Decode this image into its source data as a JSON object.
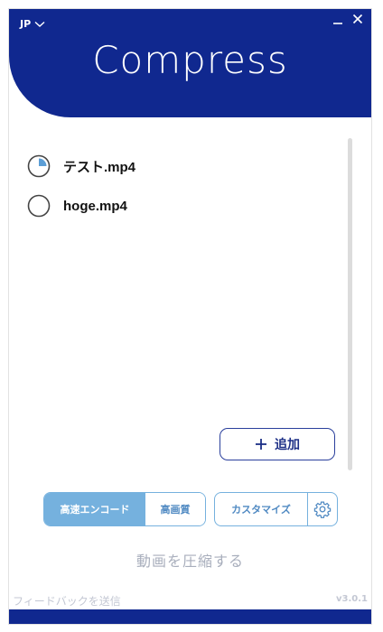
{
  "header": {
    "language": "JP",
    "app_title": "Compress",
    "brand_color": "#10288f"
  },
  "files": [
    {
      "name": "テスト.mp4",
      "progress": 0.25
    },
    {
      "name": "hoge.mp4",
      "progress": 0
    }
  ],
  "actions": {
    "add_label": "追加",
    "mode_fast": "高速エンコード",
    "mode_quality": "高画質",
    "selected_mode": "高速エンコード",
    "customize_label": "カスタマイズ",
    "compress_label": "動画を圧縮する"
  },
  "footer": {
    "feedback": "フィードバックを送信",
    "version": "v3.0.1"
  },
  "icons": [
    "chevron-down-icon",
    "minimize-icon",
    "close-icon",
    "progress-ring-icon",
    "plus-icon",
    "gear-icon"
  ],
  "colors": {
    "accent": "#75b1de",
    "progress_fill": "#5b9ed6",
    "muted_text": "#a8aebc"
  }
}
